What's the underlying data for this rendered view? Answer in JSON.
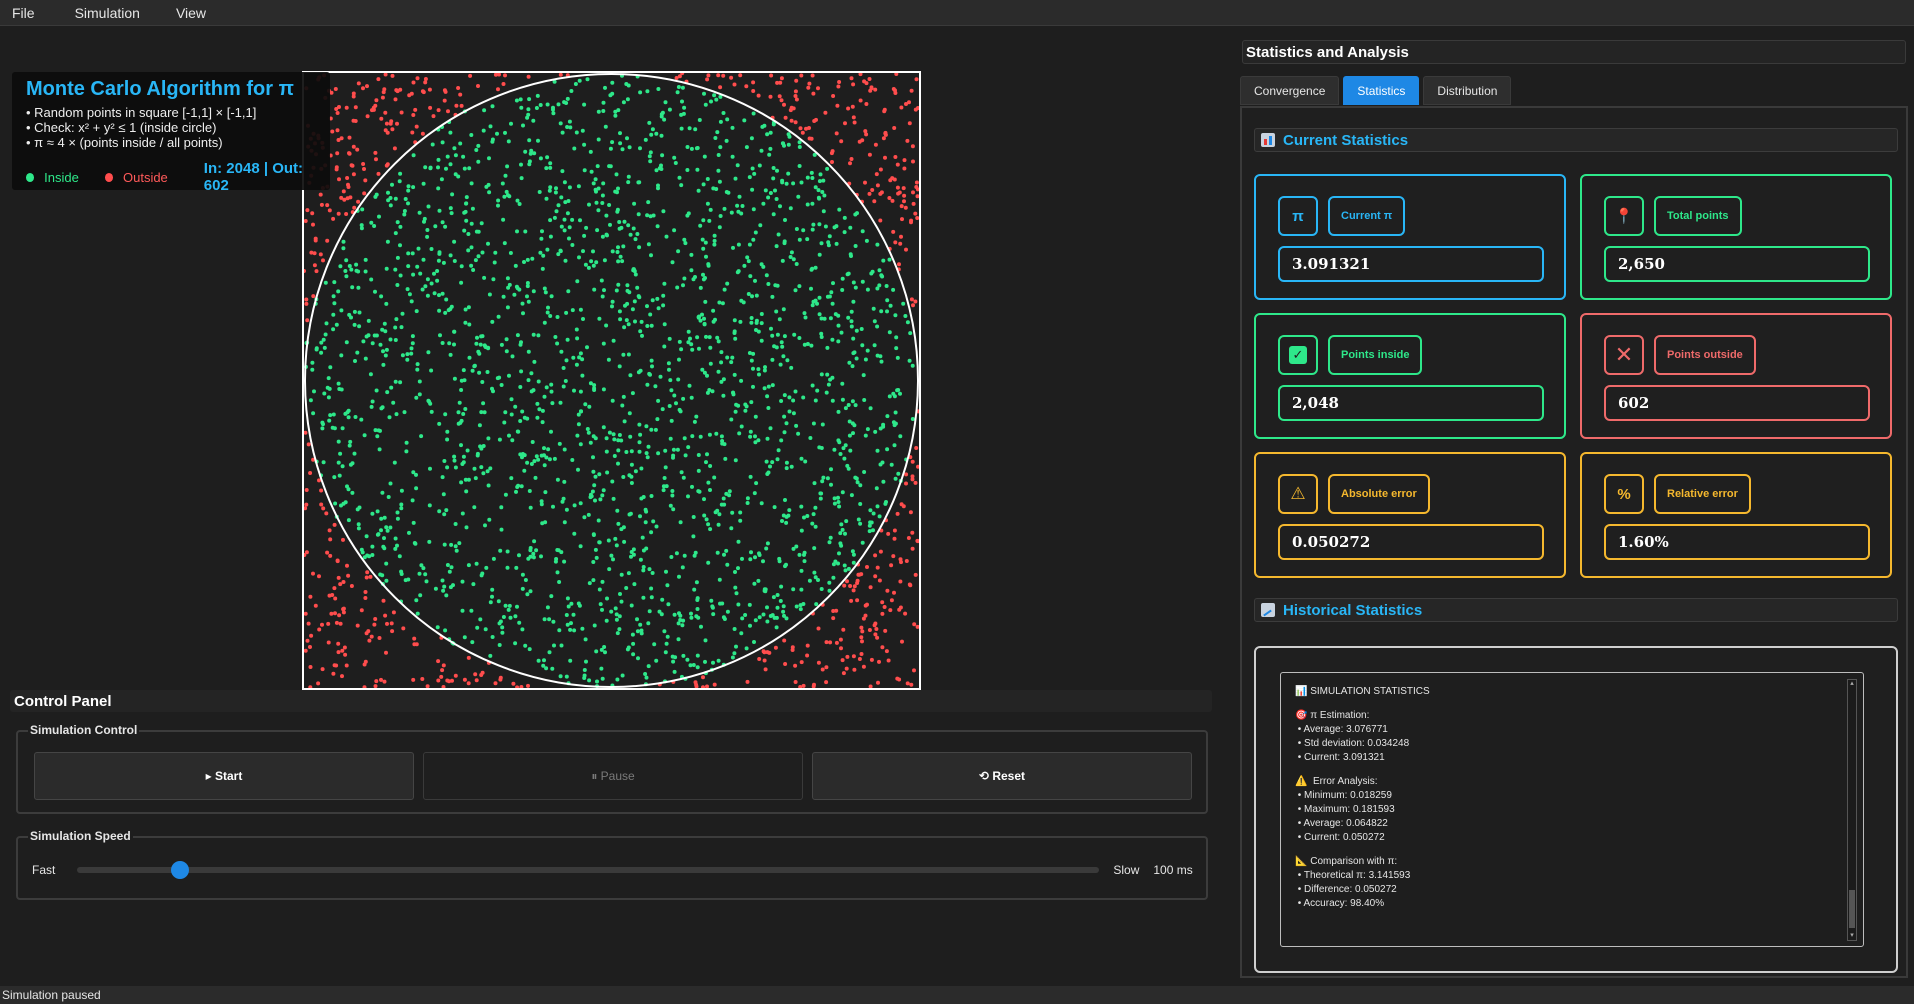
{
  "menu": {
    "items": [
      "File",
      "Simulation",
      "View"
    ]
  },
  "info": {
    "title": "Monte Carlo Algorithm for π",
    "lines": [
      "• Random points in square [-1,1] × [-1,1]",
      "• Check: x² + y² ≤ 1 (inside circle)",
      "• π ≈ 4 × (points inside / all points)"
    ],
    "legend_inside": "Inside",
    "legend_outside": "Outside",
    "counts": "In: 2048 | Out: 602",
    "colors": {
      "inside": "#2ee88a",
      "outside": "#ff4d4d",
      "circle": "#ffffff"
    }
  },
  "simulation": {
    "points_inside": 2048,
    "points_outside": 602
  },
  "control_panel": {
    "title": "Control Panel",
    "sim_control_title": "Simulation Control",
    "start": "▸ Start",
    "pause": "⏸ Pause",
    "reset": "⟲ Reset",
    "speed_title": "Simulation Speed",
    "fast_label": "Fast",
    "slow_label": "Slow",
    "speed_value": "100 ms",
    "speed_fraction": 0.1
  },
  "right": {
    "title": "Statistics and Analysis",
    "tabs": [
      "Convergence",
      "Statistics",
      "Distribution"
    ],
    "current_header": "Current Statistics",
    "historical_header": "Historical Statistics",
    "cards": {
      "current_pi": {
        "icon": "π",
        "label": "Current π",
        "value": "3.091321"
      },
      "total_points": {
        "icon": "📍",
        "label": "Total points",
        "value": "2,650"
      },
      "points_inside": {
        "icon": "✓",
        "label": "Points inside",
        "value": "2,048"
      },
      "points_outside": {
        "icon": "✕",
        "label": "Points outside",
        "value": "602"
      },
      "absolute_error": {
        "icon": "⚠",
        "label": "Absolute error",
        "value": "0.050272"
      },
      "relative_error": {
        "icon": "%",
        "label": "Relative error",
        "value": "1.60%"
      }
    },
    "history": {
      "title": "📊 SIMULATION STATISTICS",
      "pi_header": "🎯 π Estimation:",
      "pi_average": " • Average: 3.076771",
      "pi_std": " • Std deviation: 0.034248",
      "pi_current": " • Current: 3.091321",
      "err_header": "⚠️  Error Analysis:",
      "err_min": " • Minimum: 0.018259",
      "err_max": " • Maximum: 0.181593",
      "err_avg": " • Average: 0.064822",
      "err_current": " • Current: 0.050272",
      "cmp_header": "📐 Comparison with π:",
      "cmp_theoretical": " • Theoretical π: 3.141593",
      "cmp_difference": " • Difference: 0.050272",
      "cmp_accuracy": " • Accuracy: 98.40%"
    }
  },
  "status": "Simulation paused"
}
